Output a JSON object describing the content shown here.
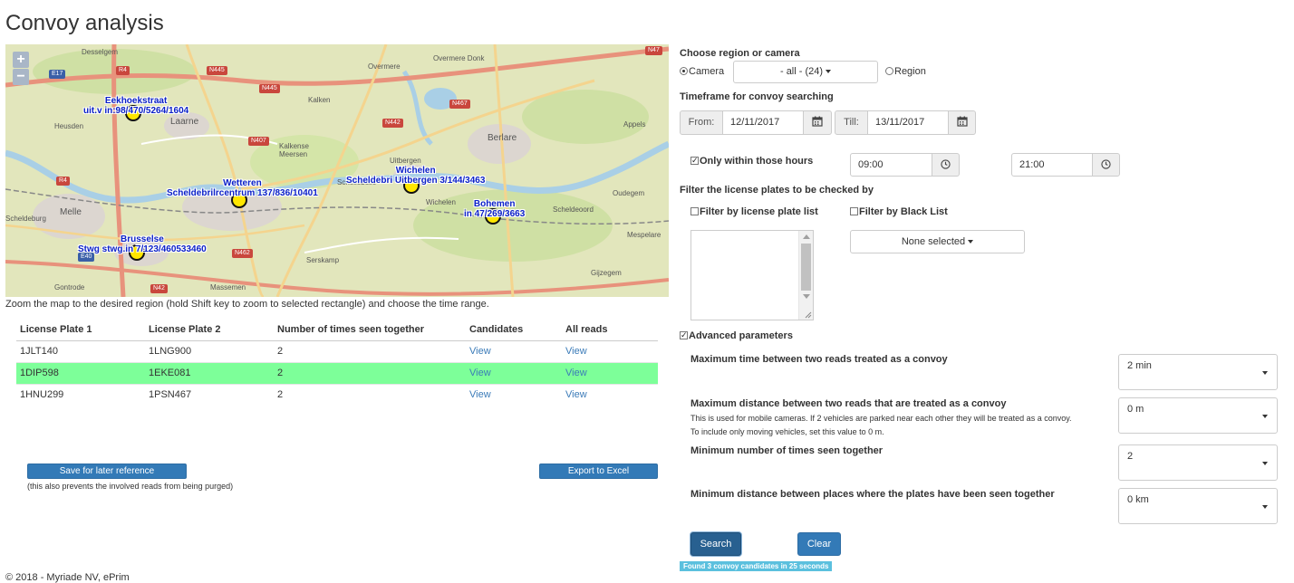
{
  "page_title": "Convoy analysis",
  "footer": "© 2018 - Myriade NV, ePrim",
  "map": {
    "zoom_in": "+",
    "zoom_out": "−",
    "hint": "Zoom the map to the desired region (hold Shift key to zoom to selected rectangle) and choose the time range.",
    "cameras": [
      {
        "name": "Eekhoekstraat",
        "id": "uit.v in:98/470/5264/1604"
      },
      {
        "name": "Wetteren",
        "id": "Scheldebrilrcentrum 137/836/10401"
      },
      {
        "name": "Wichelen",
        "id": "Scheldebri Uitbergen 3/144/3463"
      },
      {
        "name": "Bohemen",
        "id": "in 47/269/3663"
      },
      {
        "name": "Brusselse",
        "id": "Stwg stwg.in 7/123/460533460"
      }
    ],
    "places": [
      "Desselgem",
      "Overmere",
      "Overmere Donk",
      "Kalken",
      "Laarne",
      "Heusden",
      "Kalkense Meersen",
      "Berlare",
      "Appels",
      "Uitbergen",
      "Schellebelle",
      "Wichelen",
      "Oudegem",
      "Melle",
      "Serskamp",
      "Mespelare",
      "Gontrode",
      "Massemen",
      "Gijzegem",
      "Scheldeoord",
      "Scheldeburg"
    ],
    "roads": [
      "E17",
      "R4",
      "N445",
      "N445",
      "N442",
      "N467",
      "N407",
      "N47",
      "N42",
      "N462",
      "R4",
      "E40"
    ]
  },
  "table": {
    "headers": [
      "License Plate 1",
      "License Plate 2",
      "Number of times seen together",
      "Candidates",
      "All reads"
    ],
    "rows": [
      {
        "plate1": "1JLT140",
        "plate2": "1LNG900",
        "count": "2",
        "candidates": "View",
        "reads": "View"
      },
      {
        "plate1": "1DIP598",
        "plate2": "1EKE081",
        "count": "2",
        "candidates": "View",
        "reads": "View"
      },
      {
        "plate1": "1HNU299",
        "plate2": "1PSN467",
        "count": "2",
        "candidates": "View",
        "reads": "View"
      }
    ],
    "highlighted_row": 1
  },
  "save_button": "Save for later reference",
  "save_note": "(this also prevents the involved reads from being purged)",
  "export_button": "Export to Excel",
  "panel": {
    "choose_label": "Choose region or camera",
    "camera_label": "Camera",
    "camera_dropdown": "- all - (24)",
    "region_label": "Region",
    "timeframe_label": "Timeframe for convoy searching",
    "from_label": "From:",
    "from_value": "12/11/2017",
    "till_label": "Till:",
    "till_value": "13/11/2017",
    "hours_label": "Only within those hours",
    "hour_from": "09:00",
    "hour_to": "21:00",
    "filter_label": "Filter the license plates to be checked by",
    "filter_plate_list": "Filter by license plate list",
    "filter_black_list": "Filter by Black List",
    "none_selected": "None selected",
    "advanced_label": "Advanced parameters",
    "advanced": [
      {
        "label": "Maximum time between two reads treated as a convoy",
        "value": "2 min",
        "note1": "",
        "note2": ""
      },
      {
        "label": "Maximum distance between two reads that are treated as a convoy",
        "value": "0 m",
        "note1": "This is used for mobile cameras. If 2 vehicles are parked near each other they will be treated as a convoy.",
        "note2": "To include only moving vehicles, set this value to 0 m."
      },
      {
        "label": "Minimum number of times seen together",
        "value": "2",
        "note1": "",
        "note2": ""
      },
      {
        "label": "Minimum distance between places where the plates have been seen together",
        "value": "0 km",
        "note1": "",
        "note2": ""
      }
    ],
    "search_button": "Search",
    "clear_button": "Clear",
    "status": "Found 3 convoy candidates in 25 seconds"
  },
  "colors": {
    "primary": "#337ab7",
    "highlight_row": "#7dff99",
    "status_bg": "#5bc0de",
    "camera_label": "#0b20c8"
  },
  "icons": {
    "calendar": "calendar-icon",
    "clock": "clock-icon",
    "camera_marker": "camera-marker-icon"
  }
}
